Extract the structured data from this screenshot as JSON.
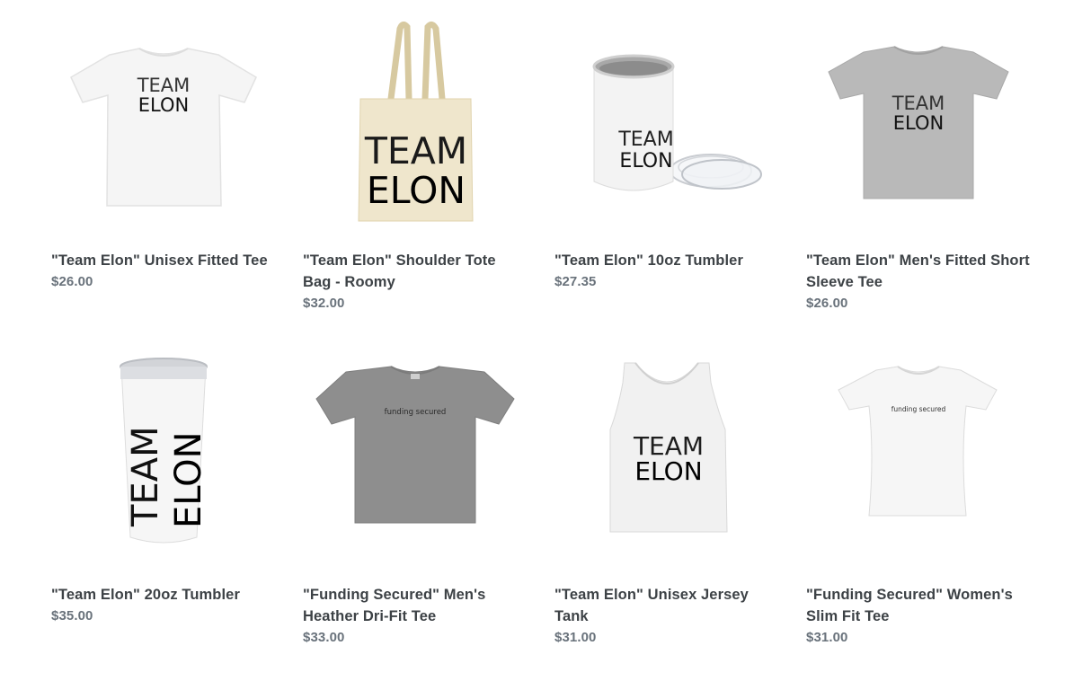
{
  "products": [
    {
      "title": "\"Team Elon\" Unisex Fitted Tee",
      "price": "$26.00",
      "image": "white-tshirt-team-elon"
    },
    {
      "title": "\"Team Elon\" Shoulder Tote Bag - Roomy",
      "price": "$32.00",
      "image": "canvas-tote-team-elon"
    },
    {
      "title": "\"Team Elon\" 10oz Tumbler",
      "price": "$27.35",
      "image": "short-tumbler-team-elon"
    },
    {
      "title": "\"Team Elon\" Men's Fitted Short Sleeve Tee",
      "price": "$26.00",
      "image": "grey-tshirt-team-elon"
    },
    {
      "title": "\"Team Elon\" 20oz Tumbler",
      "price": "$35.00",
      "image": "tall-tumbler-team-elon"
    },
    {
      "title": "\"Funding Secured\" Men's Heather Dri-Fit Tee",
      "price": "$33.00",
      "image": "grey-dri-fit-tee-funding-secured"
    },
    {
      "title": "\"Team Elon\" Unisex Jersey Tank",
      "price": "$31.00",
      "image": "white-tank-team-elon"
    },
    {
      "title": "\"Funding Secured\" Women's Slim Fit Tee",
      "price": "$31.00",
      "image": "white-womens-tee-funding-secured"
    }
  ],
  "print": {
    "team": "TEAM",
    "elon": "ELON",
    "funding": "funding secured"
  },
  "colors": {
    "title": "#3d4246",
    "price": "#69727b",
    "shirt_white": "#f4f4f4",
    "shirt_grey": "#b9b9b9",
    "tote": "#efe6cc"
  }
}
